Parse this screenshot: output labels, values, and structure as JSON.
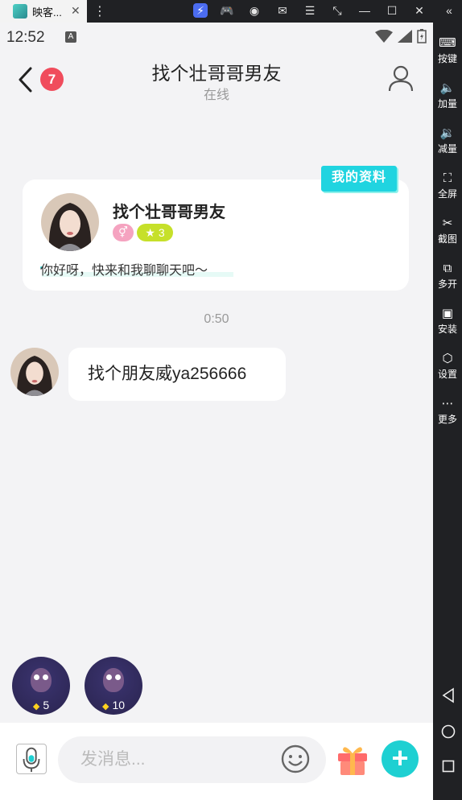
{
  "emulator": {
    "tab_title": "映客...",
    "tab_close": "✕",
    "menu_dots": "⋮",
    "toolbar_icons": [
      "sync-icon",
      "gamepad-icon",
      "account-icon",
      "mail-icon",
      "menu-icon",
      "resize-icon",
      "minimize-icon",
      "maximize-icon",
      "close-icon",
      "collapse-icon"
    ],
    "sidebar": [
      {
        "label": "按键",
        "icon": "keyboard-icon"
      },
      {
        "label": "加量",
        "icon": "volume-up-icon"
      },
      {
        "label": "减量",
        "icon": "volume-down-icon"
      },
      {
        "label": "全屏",
        "icon": "fullscreen-icon"
      },
      {
        "label": "截图",
        "icon": "scissors-icon"
      },
      {
        "label": "多开",
        "icon": "multi-instance-icon"
      },
      {
        "label": "安装",
        "icon": "apk-install-icon"
      },
      {
        "label": "设置",
        "icon": "settings-icon"
      },
      {
        "label": "更多",
        "icon": "more-icon"
      }
    ],
    "nav": [
      "back-nav-icon",
      "home-nav-icon",
      "recents-nav-icon"
    ]
  },
  "status": {
    "time": "12:52",
    "a_badge": "A"
  },
  "header": {
    "unread_count": "7",
    "title": "找个壮哥哥男友",
    "subtitle": "在线"
  },
  "profile_card": {
    "tag": "我的资料",
    "name": "找个壮哥哥男友",
    "gender_symbol": "⚥",
    "level": "3",
    "greeting": "你好呀，快来和我聊聊天吧～"
  },
  "chat": {
    "timestamp": "0:50",
    "messages": [
      {
        "text": "找个朋友威ya256666"
      }
    ]
  },
  "gifts": [
    {
      "price": "5"
    },
    {
      "price": "10"
    }
  ],
  "composer": {
    "placeholder": "发消息..."
  },
  "colors": {
    "accent": "#1ed0d2",
    "badge": "#f04c5c",
    "level": "#c6e02a",
    "tag": "#20d4e0"
  }
}
